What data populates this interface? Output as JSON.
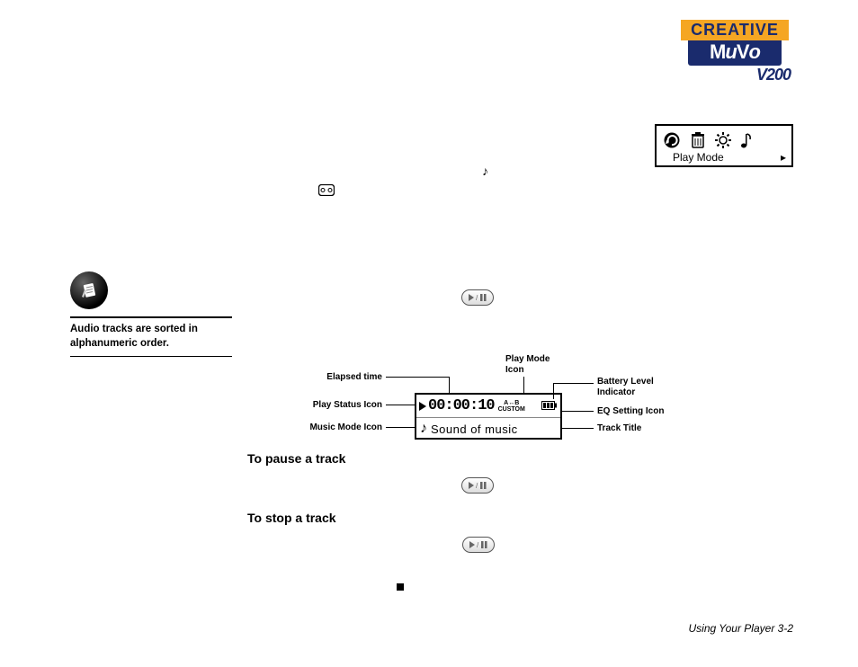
{
  "logo": {
    "brand": "CREATIVE",
    "product": "MuVo",
    "model": "V200"
  },
  "playmode_box": {
    "label": "Play Mode",
    "arrow": "▸",
    "icons": [
      "repeat-icon",
      "trash-icon",
      "gear-icon",
      "music-note-icon"
    ]
  },
  "sidebar_note": "Audio tracks are sorted in alphanumeric order.",
  "headings": {
    "pause": "To pause a track",
    "stop": "To stop a track"
  },
  "lcd": {
    "time": "00:00:10",
    "custom_line1": "A↔B",
    "custom_line2": "CUSTOM",
    "title": "Sound of music"
  },
  "labels": {
    "elapsed": "Elapsed time",
    "play_status": "Play Status Icon",
    "music_mode": "Music Mode Icon",
    "play_mode": "Play Mode\nIcon",
    "battery": "Battery Level\nIndicator",
    "eq": "EQ Setting Icon",
    "track_title": "Track Title"
  },
  "footer": "Using Your Player 3-2"
}
